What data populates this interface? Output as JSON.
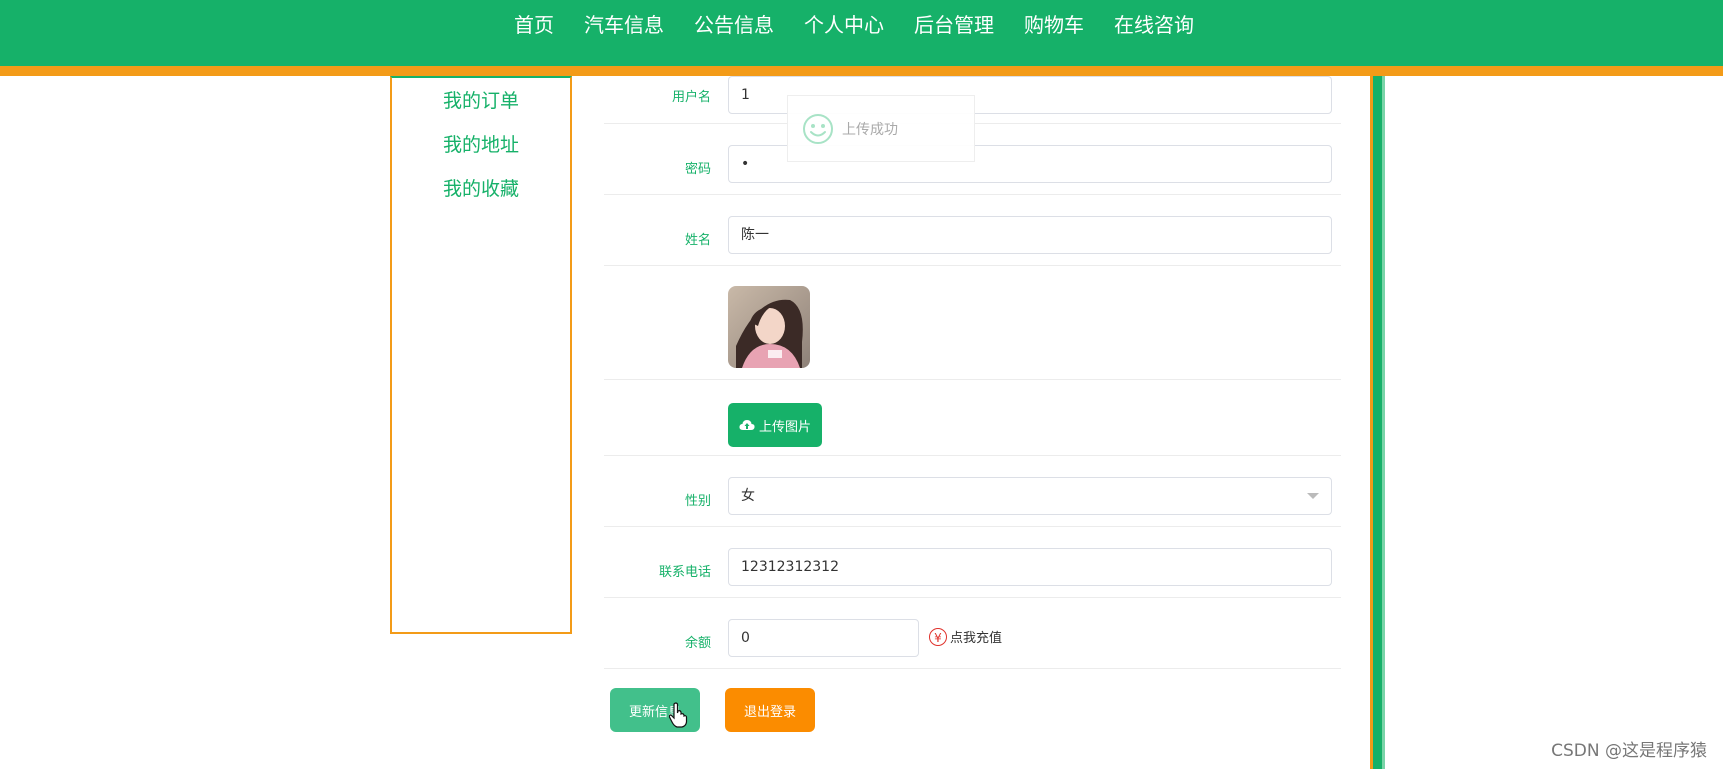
{
  "nav": {
    "items": [
      "首页",
      "汽车信息",
      "公告信息",
      "个人中心",
      "后台管理",
      "购物车",
      "在线咨询"
    ]
  },
  "sidebar": {
    "items": [
      "我的订单",
      "我的地址",
      "我的收藏"
    ]
  },
  "form": {
    "username": {
      "label": "用户名",
      "value": "1"
    },
    "password": {
      "label": "密码",
      "value": "•"
    },
    "name": {
      "label": "姓名",
      "value": "陈一"
    },
    "upload_label": "上传图片",
    "gender": {
      "label": "性别",
      "value": "女"
    },
    "phone": {
      "label": "联系电话",
      "value": "12312312312"
    },
    "balance": {
      "label": "余额",
      "value": "0",
      "recharge_label": "点我充值",
      "recharge_icon": "yen-icon",
      "recharge_symbol": "¥"
    }
  },
  "buttons": {
    "update": "更新信息",
    "logout": "退出登录"
  },
  "toast": {
    "text": "上传成功",
    "icon": "smile-icon"
  },
  "watermark": "CSDN @这是程序猿",
  "colors": {
    "primary": "#16b169",
    "accent": "#f39b18",
    "update_button": "#42c08b",
    "logout_button": "#fb8c00"
  }
}
